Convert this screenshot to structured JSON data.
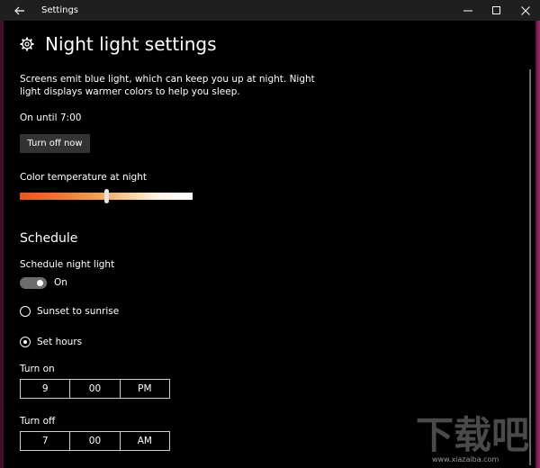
{
  "window": {
    "title": "Settings",
    "back_icon": "back-arrow-icon",
    "controls": [
      "minimize-icon",
      "maximize-icon",
      "close-icon"
    ]
  },
  "page": {
    "title": "Night light settings",
    "icon": "gear-icon",
    "description": "Screens emit blue light, which can keep you up at night. Night light displays warmer colors to help you sleep.",
    "status": "On until 7:00",
    "turn_off_button": "Turn off now"
  },
  "color_temperature": {
    "label": "Color temperature at night",
    "value": 0.5
  },
  "schedule": {
    "section_title": "Schedule",
    "schedule_label": "Schedule night light",
    "toggle_state": "On",
    "options": [
      {
        "label": "Sunset to sunrise",
        "selected": false
      },
      {
        "label": "Set hours",
        "selected": true
      }
    ],
    "turn_on": {
      "label": "Turn on",
      "hour": "9",
      "minute": "00",
      "period": "PM"
    },
    "turn_off": {
      "label": "Turn off",
      "hour": "7",
      "minute": "00",
      "period": "AM"
    }
  },
  "watermark": {
    "logo_text": "下载吧",
    "url": "www.xiazaiba.com"
  }
}
